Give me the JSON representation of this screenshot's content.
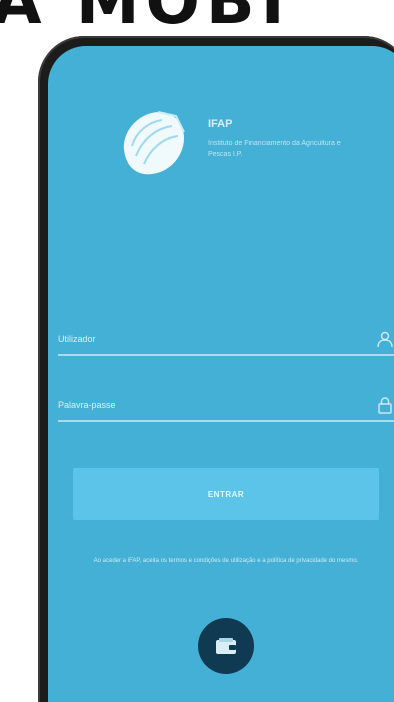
{
  "headline": {
    "text": "A MOBI"
  },
  "app": {
    "title": "IFAP",
    "subtitle": "Instituto de Financiamento da Agricultura e Pescas I.P.",
    "logo_icon": "ifap-shell-logo"
  },
  "login": {
    "username_placeholder": "Utilizador",
    "password_placeholder": "Palavra-passe",
    "username_icon": "user-icon",
    "password_icon": "lock-icon",
    "button_label": "ENTRAR",
    "footnote": "Ao aceder a iFAP, aceita os termos e condições de utilização e a política de privacidade do mesmo.",
    "fab_icon": "wallet-icon"
  },
  "colors": {
    "screen_background": "#45b0d6",
    "button_background": "#5bc4e8",
    "fab_background": "#0f3a52",
    "phone_frame": "#1c1c1c"
  }
}
